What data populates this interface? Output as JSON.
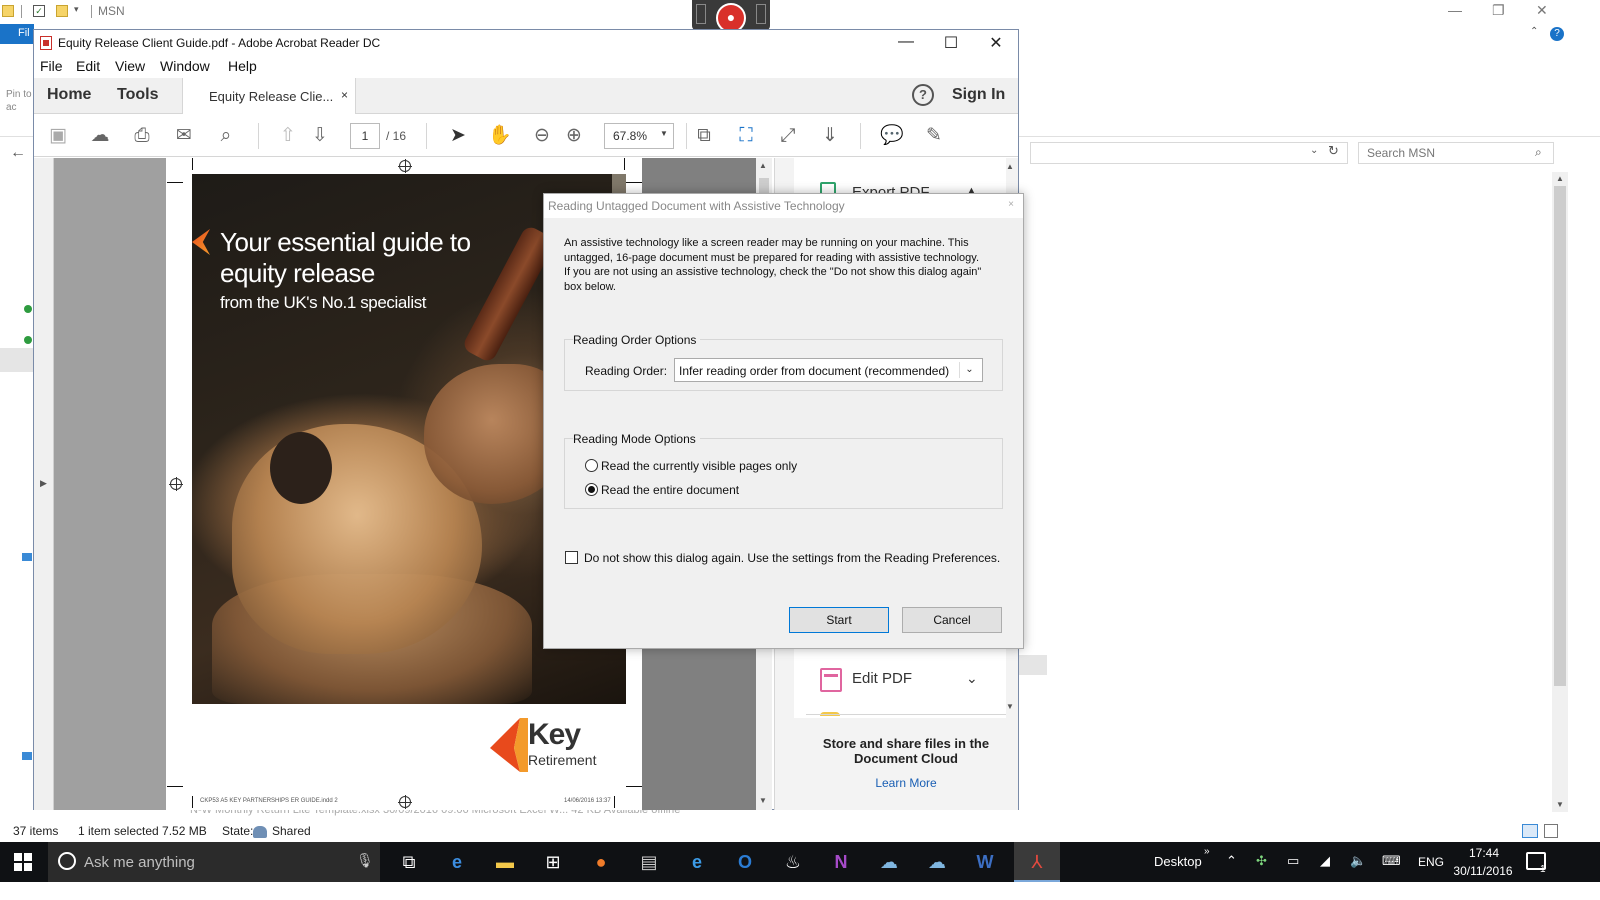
{
  "explorer": {
    "title": "MSN",
    "ribbon_tab": "Fil",
    "pin_label": "Pin to\nac",
    "search_placeholder": "Search MSN",
    "status": {
      "count": "37 items",
      "selected": "1 item selected  7.52 MB",
      "state_label": "State:",
      "state_value": "Shared"
    },
    "ghost_row": "N-W Monthly Return Lite Template.xlsx   30/09/2016 09:06     Microsoft Excel W...      42 KB     Available offline"
  },
  "acrobat": {
    "title": "Equity Release Client Guide.pdf - Adobe Acrobat Reader DC",
    "menu": [
      "File",
      "Edit",
      "View",
      "Window",
      "Help"
    ],
    "nav_home": "Home",
    "nav_tools": "Tools",
    "doc_tab": "Equity Release Clie...",
    "doc_tab_close": "×",
    "help": "?",
    "sign_in": "Sign In",
    "page_current": "1",
    "page_total": "/ 16",
    "zoom": "67.8%",
    "cover": {
      "headline": "Your essential guide to equity release",
      "subhead": "from the UK's No.1 specialist",
      "logo_word": "Key",
      "logo_sub": "Retirement",
      "footer_left": "CKP53 A5 KEY PARTNERSHIPS ER GUIDE.indd  2",
      "footer_right": "14/06/2016   13:37"
    },
    "right_pane": {
      "export_label": "Export PDF",
      "edit_label": "Edit PDF",
      "cloud_text": "Store and share files in the Document Cloud",
      "learn_more": "Learn More"
    }
  },
  "dialog": {
    "title": "Reading Untagged Document with Assistive Technology",
    "close": "×",
    "description": "An assistive technology like a screen reader may be running on your machine. This untagged, 16-page document must be prepared for reading with assistive technology. If you are not using an assistive technology, check the \"Do not show this dialog again\" box below.",
    "reading_order_group": "Reading Order Options",
    "reading_order_label": "Reading Order:",
    "reading_order_value": "Infer reading order from document (recommended)",
    "reading_mode_group": "Reading Mode Options",
    "mode_visible": "Read the currently visible pages only",
    "mode_entire": "Read the entire document",
    "mode_selected": "entire",
    "dont_show": "Do not show this dialog again. Use the settings from the Reading Preferences.",
    "start": "Start",
    "cancel": "Cancel"
  },
  "taskbar": {
    "search_placeholder": "Ask me anything",
    "desktop": "Desktop",
    "language": "ENG",
    "time": "17:44",
    "date": "30/11/2016",
    "notifications": "1"
  },
  "colors": {
    "accent_orange": "#e84a1c",
    "acrobat_red": "#c9302a",
    "link_blue": "#1a5fb4",
    "taskbar": "#0f1114"
  }
}
